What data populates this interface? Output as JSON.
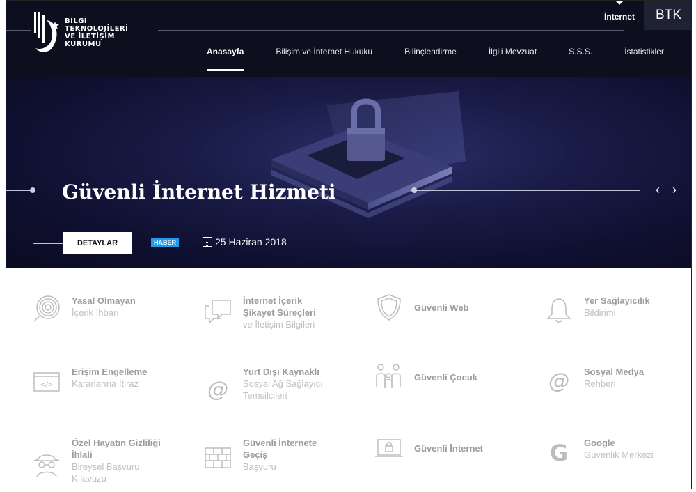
{
  "logo": {
    "lines": [
      "BİLGİ",
      "TEKNOLOJİLERİ",
      "VE İLETİŞİM",
      "KURUMU"
    ]
  },
  "topbar": {
    "internet": "İnternet",
    "btk": "BTK"
  },
  "nav": {
    "items": [
      {
        "label": "Anasayfa",
        "active": true
      },
      {
        "label": "Bilişim ve İnternet Hukuku",
        "active": false
      },
      {
        "label": "Bilinçlendirme",
        "active": false
      },
      {
        "label": "İlgili Mevzuat",
        "active": false
      },
      {
        "label": "S.S.S.",
        "active": false
      },
      {
        "label": "İstatistikler",
        "active": false
      }
    ]
  },
  "hero": {
    "title": "Güvenli İnternet Hizmeti",
    "button": "DETAYLAR",
    "badge": "HABER",
    "date": "25 Haziran 2018",
    "prev": "‹",
    "next": "›"
  },
  "services": [
    {
      "icon": "fingerprint-icon",
      "bold": [
        "Yasal Olmayan"
      ],
      "light": [
        "İçerik İhbarı"
      ]
    },
    {
      "icon": "chat-bubble-icon",
      "bold": [
        "İnternet İçerik",
        "Şikayet Süreçleri"
      ],
      "light": [
        "ve İletişim Bilgileri"
      ]
    },
    {
      "icon": "shield-icon",
      "bold": [
        "Güvenli Web"
      ],
      "light": []
    },
    {
      "icon": "bell-icon",
      "bold": [
        "Yer Sağlayıcılık"
      ],
      "light": [
        "Bildirimi"
      ]
    },
    {
      "icon": "code-window-icon",
      "bold": [
        "Erişim Engelleme"
      ],
      "light": [
        "Kararlarına İtiraz"
      ]
    },
    {
      "icon": "at-sign-icon",
      "bold": [
        "Yurt Dışı Kaynaklı"
      ],
      "light": [
        "Sosyal Ağ Sağlayıcı",
        "Temsilcileri"
      ]
    },
    {
      "icon": "family-icon",
      "bold": [
        "Güvenli Çocuk"
      ],
      "light": []
    },
    {
      "icon": "at-sign-icon",
      "bold": [
        "Sosyal Medya"
      ],
      "light": [
        "Rehberi"
      ]
    },
    {
      "icon": "spy-icon",
      "bold": [
        "Özel Hayatın Gizliliği",
        "İhlali"
      ],
      "light": [
        "Bireysel Başvuru",
        "Kılavuzu"
      ]
    },
    {
      "icon": "firewall-icon",
      "bold": [
        "Güvenli İnternete",
        "Geçiş"
      ],
      "light": [
        "Başvuru"
      ]
    },
    {
      "icon": "locked-laptop-icon",
      "bold": [
        "Güvenli İnternet"
      ],
      "light": []
    },
    {
      "icon": "google-icon",
      "bold": [
        "Google"
      ],
      "light": [
        "Güvenlik Merkezi"
      ]
    }
  ],
  "colors": {
    "header_bg": "#0d0f1f",
    "badge": "#1e9bef",
    "service_bold": "#9c9c9c",
    "service_light": "#c0c0c0"
  }
}
